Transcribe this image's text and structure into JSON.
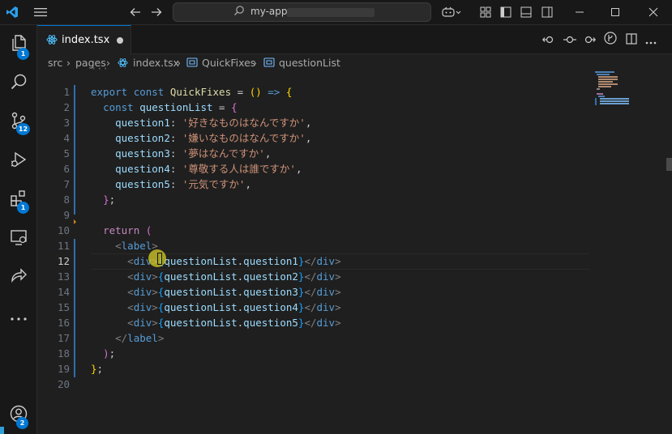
{
  "window": {
    "search_text": "my-app"
  },
  "activity_bar": {
    "explorer_badge": "1",
    "scm_badge": "12",
    "extensions_badge": "1",
    "accounts_badge": "2"
  },
  "tab": {
    "label": "index.tsx"
  },
  "breadcrumb": {
    "items": [
      "src",
      "pages",
      "index.tsx",
      "QuickFixes",
      "questionList"
    ]
  },
  "editor": {
    "ellipsis": "···",
    "active_line": 12,
    "lines": [
      {
        "n": "1",
        "tokens": [
          [
            "kw",
            "export "
          ],
          [
            "kw",
            "const "
          ],
          [
            "fn",
            "QuickFixes"
          ],
          [
            "pl",
            " = "
          ],
          [
            "br",
            "()"
          ],
          [
            "pl",
            " "
          ],
          [
            "kw",
            "=>"
          ],
          [
            "pl",
            " "
          ],
          [
            "br",
            "{"
          ]
        ]
      },
      {
        "n": "2",
        "tokens": [
          [
            "pl",
            "  "
          ],
          [
            "kw",
            "const "
          ],
          [
            "vr",
            "questionList"
          ],
          [
            "pl",
            " = "
          ],
          [
            "br2",
            "{"
          ]
        ]
      },
      {
        "n": "3",
        "tokens": [
          [
            "pl",
            "    "
          ],
          [
            "vr",
            "question1"
          ],
          [
            "pl",
            ": "
          ],
          [
            "str",
            "'好きなものはなんですか'"
          ],
          [
            "pl",
            ","
          ]
        ]
      },
      {
        "n": "4",
        "tokens": [
          [
            "pl",
            "    "
          ],
          [
            "vr",
            "question2"
          ],
          [
            "pl",
            ": "
          ],
          [
            "str",
            "'嫌いなものはなんですか'"
          ],
          [
            "pl",
            ","
          ]
        ]
      },
      {
        "n": "5",
        "tokens": [
          [
            "pl",
            "    "
          ],
          [
            "vr",
            "question3"
          ],
          [
            "pl",
            ": "
          ],
          [
            "str",
            "'夢はなんですか'"
          ],
          [
            "pl",
            ","
          ]
        ]
      },
      {
        "n": "6",
        "tokens": [
          [
            "pl",
            "    "
          ],
          [
            "vr",
            "question4"
          ],
          [
            "pl",
            ": "
          ],
          [
            "str",
            "'尊敬する人は誰ですか'"
          ],
          [
            "pl",
            ","
          ]
        ]
      },
      {
        "n": "7",
        "tokens": [
          [
            "pl",
            "    "
          ],
          [
            "vr",
            "question5"
          ],
          [
            "pl",
            ": "
          ],
          [
            "str",
            "'元気ですか'"
          ],
          [
            "pl",
            ","
          ]
        ]
      },
      {
        "n": "8",
        "tokens": [
          [
            "pl",
            "  "
          ],
          [
            "br2",
            "}"
          ],
          [
            "pl",
            ";"
          ]
        ]
      },
      {
        "n": "9",
        "tokens": []
      },
      {
        "n": "10",
        "tokens": [
          [
            "pl",
            "  "
          ],
          [
            "ret",
            "return "
          ],
          [
            "br2",
            "("
          ]
        ]
      },
      {
        "n": "11",
        "tokens": [
          [
            "pl",
            "    "
          ],
          [
            "tagp",
            "<"
          ],
          [
            "tag",
            "label"
          ],
          [
            "tagp",
            ">"
          ]
        ]
      },
      {
        "n": "12",
        "tokens": [
          [
            "pl",
            "      "
          ],
          [
            "tagp",
            "<"
          ],
          [
            "tag",
            "div"
          ],
          [
            "tagp",
            ">"
          ],
          [
            "br3",
            "{"
          ],
          [
            "vr",
            "questionList"
          ],
          [
            "pl",
            "."
          ],
          [
            "vr",
            "question1"
          ],
          [
            "br3",
            "}"
          ],
          [
            "tagp",
            "</"
          ],
          [
            "tag",
            "div"
          ],
          [
            "tagp",
            ">"
          ]
        ]
      },
      {
        "n": "13",
        "tokens": [
          [
            "pl",
            "      "
          ],
          [
            "tagp",
            "<"
          ],
          [
            "tag",
            "div"
          ],
          [
            "tagp",
            ">"
          ],
          [
            "br3",
            "{"
          ],
          [
            "vr",
            "questionList"
          ],
          [
            "pl",
            "."
          ],
          [
            "vr",
            "question2"
          ],
          [
            "br3",
            "}"
          ],
          [
            "tagp",
            "</"
          ],
          [
            "tag",
            "div"
          ],
          [
            "tagp",
            ">"
          ]
        ]
      },
      {
        "n": "14",
        "tokens": [
          [
            "pl",
            "      "
          ],
          [
            "tagp",
            "<"
          ],
          [
            "tag",
            "div"
          ],
          [
            "tagp",
            ">"
          ],
          [
            "br3",
            "{"
          ],
          [
            "vr",
            "questionList"
          ],
          [
            "pl",
            "."
          ],
          [
            "vr",
            "question3"
          ],
          [
            "br3",
            "}"
          ],
          [
            "tagp",
            "</"
          ],
          [
            "tag",
            "div"
          ],
          [
            "tagp",
            ">"
          ]
        ]
      },
      {
        "n": "15",
        "tokens": [
          [
            "pl",
            "      "
          ],
          [
            "tagp",
            "<"
          ],
          [
            "tag",
            "div"
          ],
          [
            "tagp",
            ">"
          ],
          [
            "br3",
            "{"
          ],
          [
            "vr",
            "questionList"
          ],
          [
            "pl",
            "."
          ],
          [
            "vr",
            "question4"
          ],
          [
            "br3",
            "}"
          ],
          [
            "tagp",
            "</"
          ],
          [
            "tag",
            "div"
          ],
          [
            "tagp",
            ">"
          ]
        ]
      },
      {
        "n": "16",
        "tokens": [
          [
            "pl",
            "      "
          ],
          [
            "tagp",
            "<"
          ],
          [
            "tag",
            "div"
          ],
          [
            "tagp",
            ">"
          ],
          [
            "br3",
            "{"
          ],
          [
            "vr",
            "questionList"
          ],
          [
            "pl",
            "."
          ],
          [
            "vr",
            "question5"
          ],
          [
            "br3",
            "}"
          ],
          [
            "tagp",
            "</"
          ],
          [
            "tag",
            "div"
          ],
          [
            "tagp",
            ">"
          ]
        ]
      },
      {
        "n": "17",
        "tokens": [
          [
            "pl",
            "    "
          ],
          [
            "tagp",
            "</"
          ],
          [
            "tag",
            "label"
          ],
          [
            "tagp",
            ">"
          ]
        ]
      },
      {
        "n": "18",
        "tokens": [
          [
            "pl",
            "  "
          ],
          [
            "br2",
            ")"
          ],
          [
            "pl",
            ";"
          ]
        ]
      },
      {
        "n": "19",
        "tokens": [
          [
            "br",
            "}"
          ],
          [
            "pl",
            ";"
          ]
        ]
      },
      {
        "n": "20",
        "tokens": []
      }
    ]
  },
  "colors": {
    "accent": "#0078d4",
    "keyword": "#569cd6",
    "string": "#ce9178",
    "variable": "#9cdcfe"
  }
}
